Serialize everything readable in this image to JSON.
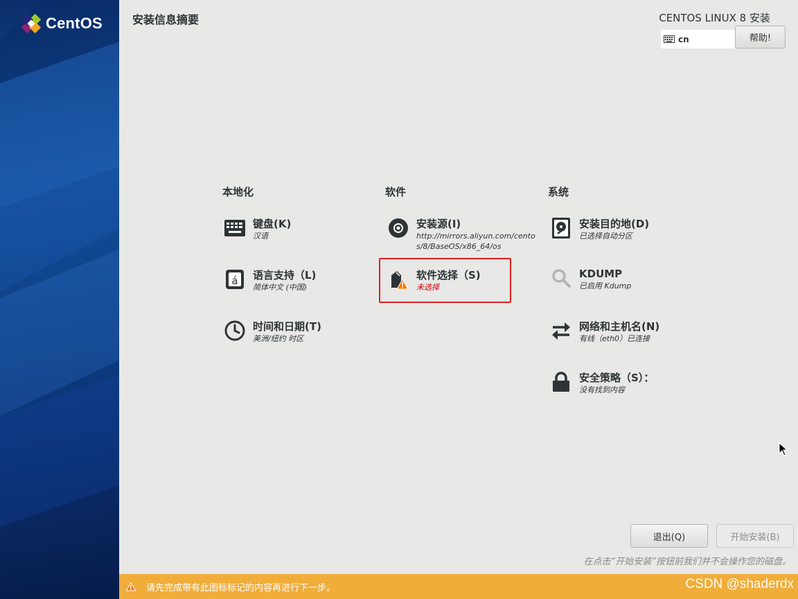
{
  "brand": {
    "logo_text": "CentOS"
  },
  "header": {
    "page_title": "安装信息摘要",
    "product_title": "CENTOS LINUX 8 安装",
    "keyboard_layout": "cn",
    "help_label": "帮助!"
  },
  "columns": {
    "localization": {
      "heading": "本地化",
      "items": [
        {
          "title": "键盘(K)",
          "status": "汉语",
          "icon": "keyboard-icon"
        },
        {
          "title": "语言支持（L)",
          "status": "简体中文 (中国)",
          "icon": "language-icon"
        },
        {
          "title": "时间和日期(T)",
          "status": "美洲/纽约 时区",
          "icon": "clock-icon"
        }
      ]
    },
    "software": {
      "heading": "软件",
      "items": [
        {
          "title": "安装源(I)",
          "status": "http://mirrors.aliyun.com/centos/8/BaseOS/x86_64/os",
          "icon": "disc-icon"
        },
        {
          "title": "软件选择（S)",
          "status": "未选择",
          "icon": "package-warning-icon",
          "warning": true
        }
      ]
    },
    "system": {
      "heading": "系统",
      "items": [
        {
          "title": "安装目的地(D)",
          "status": "已选择自动分区",
          "icon": "harddisk-icon"
        },
        {
          "title": "KDUMP",
          "status": "已启用 Kdump",
          "icon": "magnifier-icon"
        },
        {
          "title": "网络和主机名(N)",
          "status": "有线（eth0）已连接",
          "icon": "network-arrows-icon"
        },
        {
          "title": "安全策略（S）：",
          "status": "没有找到内容",
          "icon": "lock-icon"
        }
      ]
    }
  },
  "footer": {
    "quit_label": "退出(Q)",
    "begin_label": "开始安装(B)",
    "disk_note": "在点击“开始安装”按钮前我们并不会操作您的磁盘。",
    "warning_message": "请先完成带有此图标标记的内容再进行下一步。",
    "watermark": "CSDN @shaderdx"
  },
  "colors": {
    "sidebar_blue": "#0d3f86",
    "warning_bar": "#f0ad3a",
    "highlight_red": "#e0201c",
    "warning_text": "#cc0000"
  }
}
